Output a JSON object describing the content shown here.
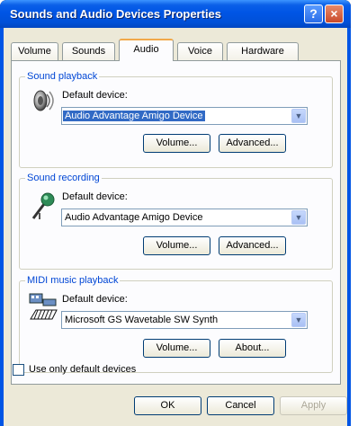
{
  "window": {
    "title": "Sounds and Audio Devices Properties",
    "help_glyph": "?",
    "close_glyph": "×"
  },
  "tabs": [
    {
      "label": "Volume"
    },
    {
      "label": "Sounds"
    },
    {
      "label": "Audio",
      "active": true
    },
    {
      "label": "Voice"
    },
    {
      "label": "Hardware"
    }
  ],
  "playback": {
    "title": "Sound playback",
    "device_label": "Default device:",
    "device_value": "Audio Advantage Amigo Device",
    "volume_button": "Volume...",
    "advanced_button": "Advanced..."
  },
  "recording": {
    "title": "Sound recording",
    "device_label": "Default device:",
    "device_value": "Audio Advantage Amigo Device",
    "volume_button": "Volume...",
    "advanced_button": "Advanced..."
  },
  "midi": {
    "title": "MIDI music playback",
    "device_label": "Default device:",
    "device_value": "Microsoft GS Wavetable SW Synth",
    "volume_button": "Volume...",
    "about_button": "About..."
  },
  "use_default_only": {
    "label": "Use only default devices",
    "checked": false
  },
  "footer": {
    "ok": "OK",
    "cancel": "Cancel",
    "apply": "Apply"
  },
  "icons": {
    "playback": "speaker-icon",
    "recording": "microphone-icon",
    "midi": "midi-keyboard-icon"
  },
  "colors": {
    "titlebar": "#0055e5",
    "dialog_bg": "#ece9d8",
    "group_label": "#0046d5",
    "selection": "#316ac5",
    "active_tab_accent": "#f1a94a"
  }
}
